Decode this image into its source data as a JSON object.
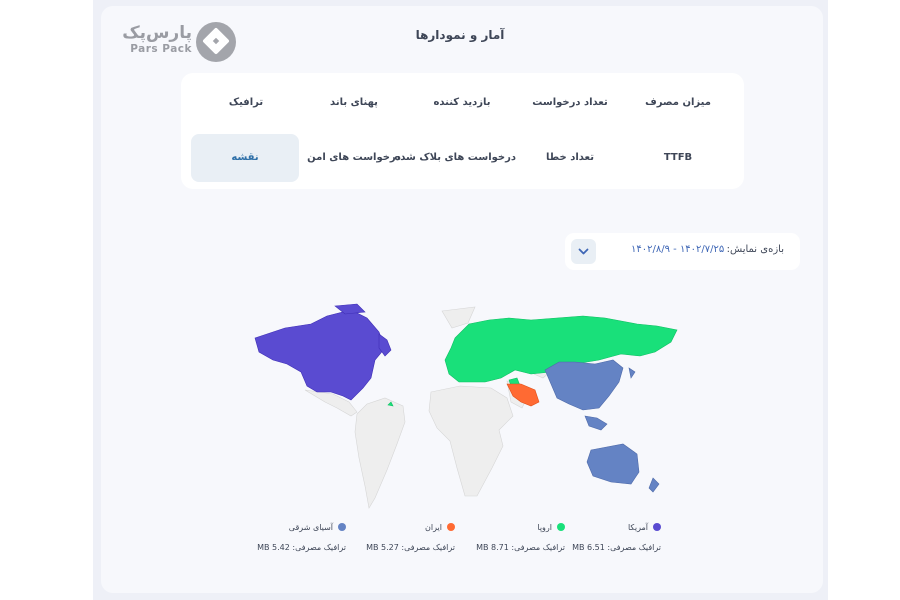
{
  "page": {
    "title": "آمار و نمودارها"
  },
  "logo": {
    "text_fa": "پارس‌پک",
    "text_en": "Pars Pack"
  },
  "tabs": [
    {
      "label": "میزان مصرف",
      "active": false
    },
    {
      "label": "تعداد درخواست",
      "active": false
    },
    {
      "label": "بازدید کننده",
      "active": false
    },
    {
      "label": "پهنای باند",
      "active": false
    },
    {
      "label": "ترافیک",
      "active": false
    },
    {
      "label": "TTFB",
      "active": false
    },
    {
      "label": "تعداد خطا",
      "active": false
    },
    {
      "label": "درخواست های بلاک شده",
      "active": false
    },
    {
      "label": "درخواست های امن",
      "active": false
    },
    {
      "label": "نقشه",
      "active": true
    }
  ],
  "date_range": {
    "label": "بازه‌ی نمایش:",
    "value": "۱۴۰۲/۷/۲۵ - ۱۴۰۲/۸/۹",
    "button_icon": "chevron-down-icon"
  },
  "map": {
    "regions": [
      {
        "name": "آمریکا",
        "color": "#5a4bd1",
        "usage": "ترافیک مصرفی: 6.51 MB"
      },
      {
        "name": "اروپا",
        "color": "#19e07a",
        "usage": "ترافیک مصرفی: 8.71 MB"
      },
      {
        "name": "ایران",
        "color": "#ff6a33",
        "usage": "ترافیک مصرفی: 5.27 MB"
      },
      {
        "name": "آسیای شرقی",
        "color": "#6483c4",
        "usage": "ترافیک مصرفی: 5.42 MB"
      }
    ],
    "base_color": "#eeeeee"
  }
}
